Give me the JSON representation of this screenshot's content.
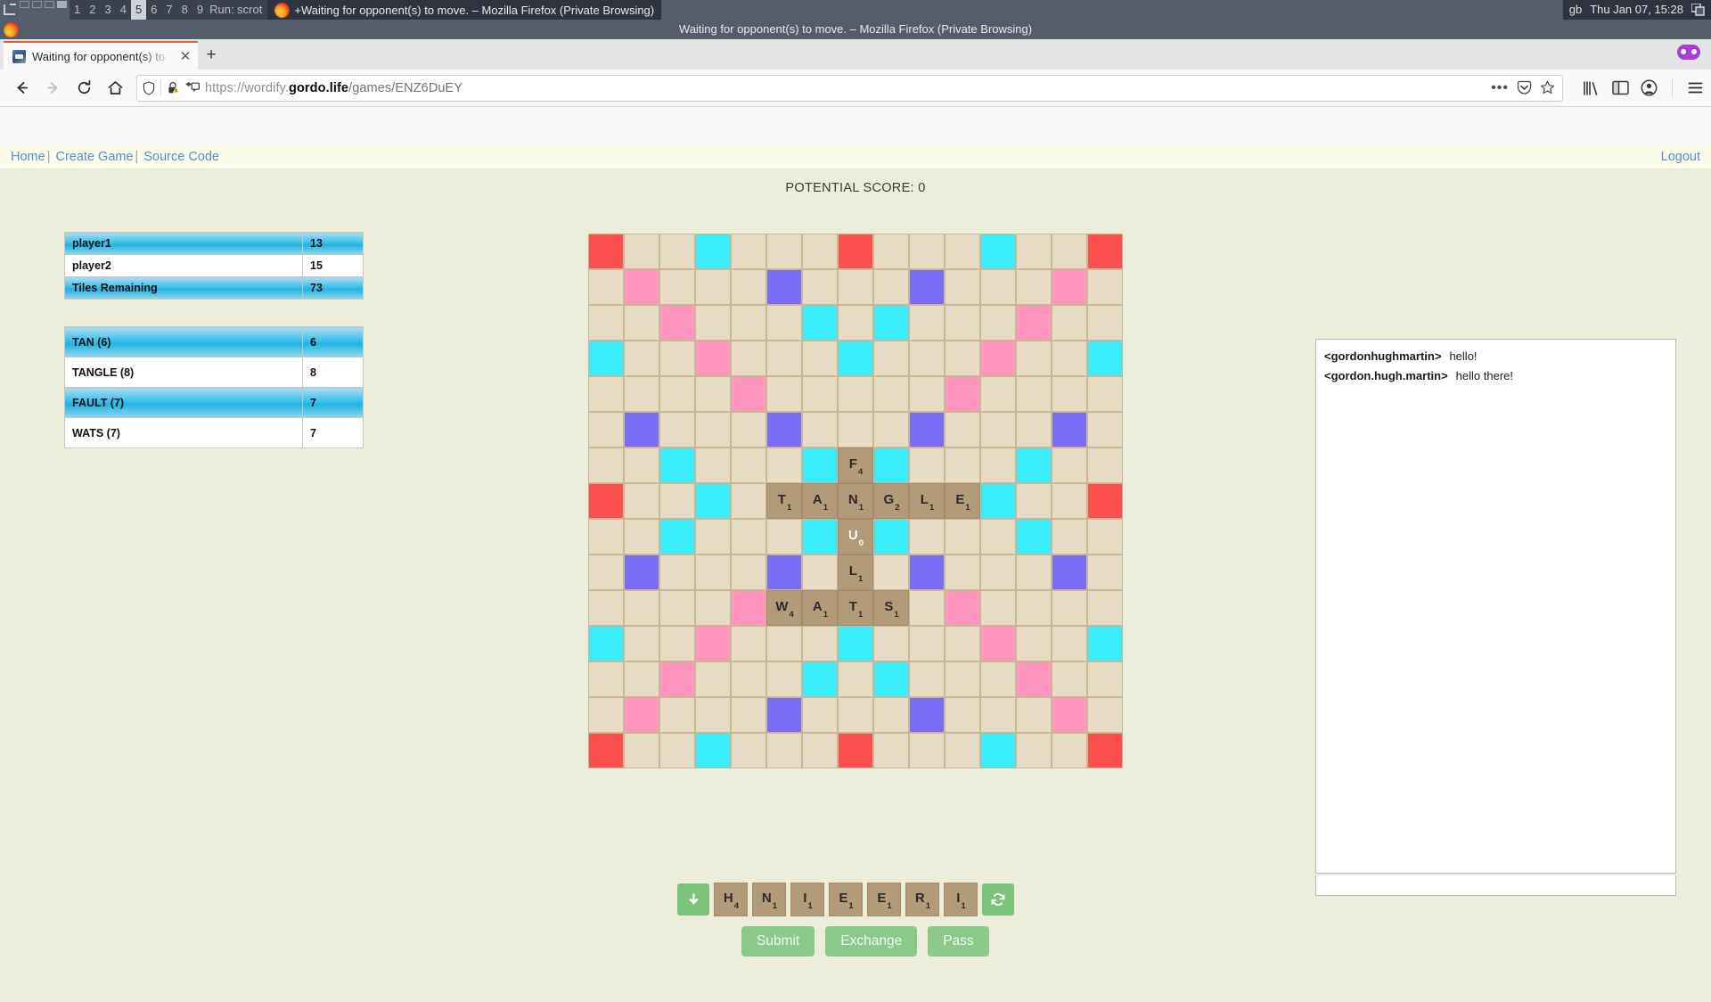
{
  "wm": {
    "desktops": [
      "1",
      "2",
      "3",
      "4",
      "5",
      "6",
      "7",
      "8",
      "9"
    ],
    "active_desktop": "5",
    "run_label": "Run: scrot",
    "taskbar_window": "+Waiting for opponent(s) to move. – Mozilla Firefox (Private Browsing)",
    "window_title": "Waiting for opponent(s) to move. – Mozilla Firefox (Private Browsing)",
    "keyboard_layout": "gb",
    "clock": "Thu Jan 07, 15:28"
  },
  "browser": {
    "tab_title": "Waiting for opponent(s) to",
    "new_tab_glyph": "+",
    "close_glyph": "✕",
    "url_display_prefix": "https://wordify.",
    "url_display_domain": "gordo.life",
    "url_display_suffix": "/games/ENZ6DuEY",
    "back_glyph": "←",
    "forward_glyph": "→",
    "reload_glyph": "↻",
    "home_glyph": "⌂",
    "menu_glyph": "☰",
    "overflow_glyph": "•••",
    "star_glyph": "☆"
  },
  "nav": {
    "home": "Home",
    "create_game": "Create Game",
    "source_code": "Source Code",
    "separator": "|",
    "logout": "Logout"
  },
  "game": {
    "potential_score_label": "POTENTIAL SCORE: 0",
    "scores": {
      "rows": [
        {
          "label": "player1",
          "value": "13",
          "highlight": true
        },
        {
          "label": "player2",
          "value": "15",
          "highlight": false
        },
        {
          "label": "Tiles Remaining",
          "value": "73",
          "highlight": true
        }
      ]
    },
    "words": {
      "rows": [
        {
          "label": "TAN (6)",
          "value": "6",
          "highlight": true
        },
        {
          "label": "TANGLE (8)",
          "value": "8",
          "highlight": false
        },
        {
          "label": "FAULT (7)",
          "value": "7",
          "highlight": true
        },
        {
          "label": "WATS (7)",
          "value": "7",
          "highlight": false
        }
      ]
    },
    "board": {
      "size": 15,
      "premium": {
        "tw": [
          [
            0,
            0
          ],
          [
            0,
            7
          ],
          [
            0,
            14
          ],
          [
            7,
            0
          ],
          [
            7,
            14
          ],
          [
            14,
            0
          ],
          [
            14,
            7
          ],
          [
            14,
            14
          ]
        ],
        "dw": [
          [
            1,
            1
          ],
          [
            1,
            13
          ],
          [
            2,
            2
          ],
          [
            2,
            12
          ],
          [
            3,
            3
          ],
          [
            3,
            11
          ],
          [
            4,
            4
          ],
          [
            4,
            10
          ],
          [
            10,
            4
          ],
          [
            10,
            10
          ],
          [
            11,
            3
          ],
          [
            11,
            11
          ],
          [
            12,
            2
          ],
          [
            12,
            12
          ],
          [
            13,
            1
          ],
          [
            13,
            13
          ]
        ],
        "tl": [
          [
            1,
            5
          ],
          [
            1,
            9
          ],
          [
            5,
            1
          ],
          [
            5,
            5
          ],
          [
            5,
            9
          ],
          [
            5,
            13
          ],
          [
            9,
            1
          ],
          [
            9,
            5
          ],
          [
            9,
            9
          ],
          [
            9,
            13
          ],
          [
            13,
            5
          ],
          [
            13,
            9
          ]
        ],
        "dl": [
          [
            0,
            3
          ],
          [
            0,
            11
          ],
          [
            2,
            6
          ],
          [
            2,
            8
          ],
          [
            3,
            0
          ],
          [
            3,
            7
          ],
          [
            3,
            14
          ],
          [
            6,
            2
          ],
          [
            6,
            6
          ],
          [
            6,
            8
          ],
          [
            6,
            12
          ],
          [
            7,
            3
          ],
          [
            7,
            11
          ],
          [
            8,
            2
          ],
          [
            8,
            6
          ],
          [
            8,
            8
          ],
          [
            8,
            12
          ],
          [
            11,
            0
          ],
          [
            11,
            7
          ],
          [
            11,
            14
          ],
          [
            12,
            6
          ],
          [
            12,
            8
          ],
          [
            14,
            3
          ],
          [
            14,
            11
          ]
        ]
      },
      "tiles": [
        {
          "row": 6,
          "col": 7,
          "letter": "F",
          "value": "4",
          "blank": false
        },
        {
          "row": 7,
          "col": 5,
          "letter": "T",
          "value": "1",
          "blank": false
        },
        {
          "row": 7,
          "col": 6,
          "letter": "A",
          "value": "1",
          "blank": false
        },
        {
          "row": 7,
          "col": 7,
          "letter": "N",
          "value": "1",
          "blank": false
        },
        {
          "row": 7,
          "col": 8,
          "letter": "G",
          "value": "2",
          "blank": false
        },
        {
          "row": 7,
          "col": 9,
          "letter": "L",
          "value": "1",
          "blank": false
        },
        {
          "row": 7,
          "col": 10,
          "letter": "E",
          "value": "1",
          "blank": false
        },
        {
          "row": 8,
          "col": 7,
          "letter": "U",
          "value": "0",
          "blank": true
        },
        {
          "row": 9,
          "col": 7,
          "letter": "L",
          "value": "1",
          "blank": false
        },
        {
          "row": 10,
          "col": 5,
          "letter": "W",
          "value": "4",
          "blank": false
        },
        {
          "row": 10,
          "col": 6,
          "letter": "A",
          "value": "1",
          "blank": false
        },
        {
          "row": 10,
          "col": 7,
          "letter": "T",
          "value": "1",
          "blank": false
        },
        {
          "row": 10,
          "col": 8,
          "letter": "S",
          "value": "1",
          "blank": false
        }
      ]
    },
    "rack": {
      "recall_glyph": "⬇",
      "shuffle_glyph": "↻",
      "tiles": [
        {
          "letter": "H",
          "value": "4"
        },
        {
          "letter": "N",
          "value": "1"
        },
        {
          "letter": "I",
          "value": "1"
        },
        {
          "letter": "E",
          "value": "1"
        },
        {
          "letter": "E",
          "value": "1"
        },
        {
          "letter": "R",
          "value": "1"
        },
        {
          "letter": "I",
          "value": "1"
        }
      ]
    },
    "actions": {
      "submit": "Submit",
      "exchange": "Exchange",
      "pass": "Pass"
    },
    "chat": {
      "messages": [
        {
          "who": "<gordonhughmartin>",
          "msg": "hello!"
        },
        {
          "who": "<gordon.hugh.martin>",
          "msg": "hello there!"
        }
      ],
      "input_value": ""
    }
  },
  "colors": {
    "triple_word": "#fc4f4f",
    "double_word": "#ff94bd",
    "triple_letter": "#7b6cf6",
    "double_letter": "#38ecfb",
    "empty_cell": "#e6dcc3",
    "tile": "#b39a78",
    "accent_button": "#8bc98b",
    "link": "#5a8ec9",
    "page_bg": "#eceddb"
  }
}
